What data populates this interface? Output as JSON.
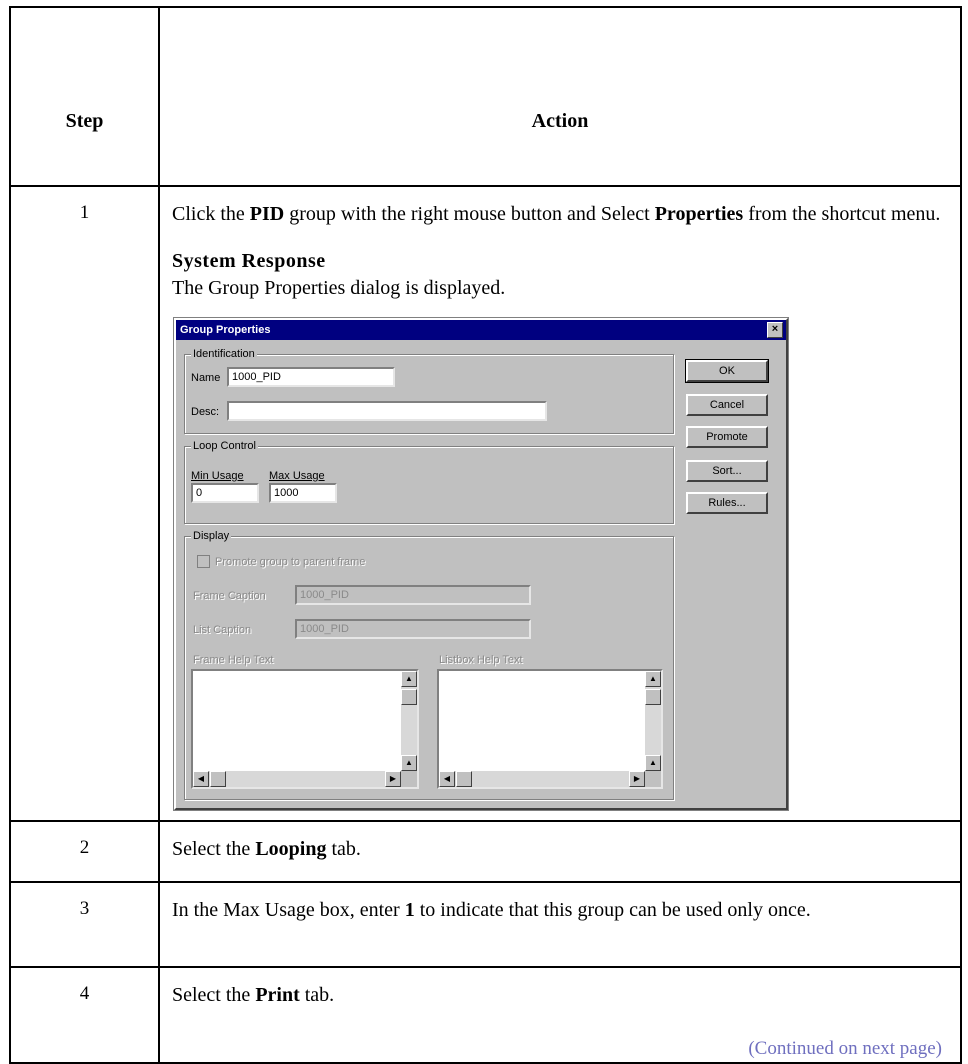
{
  "table": {
    "header_step": "Step",
    "header_action": "Action",
    "rows": [
      {
        "num": "1",
        "pre1": "Click the ",
        "b1": "PID",
        "mid1": " group with the right mouse button and Select ",
        "b2": "Properties",
        "post1": " from the shortcut menu.",
        "response_heading": "System Response",
        "response_text": "The Group Properties dialog is displayed."
      },
      {
        "num": "2",
        "pre": "Select the ",
        "bold": "Looping",
        "post": " tab."
      },
      {
        "num": "3",
        "pre": "In the Max Usage box, enter ",
        "bold": "1",
        "post": " to indicate that this group can be used only once."
      },
      {
        "num": "4",
        "pre": "Select the ",
        "bold": "Print",
        "post": " tab.",
        "continued": "(Continued on next page)"
      }
    ]
  },
  "dialog": {
    "title": "Group Properties",
    "close_glyph": "×",
    "identification": {
      "label": "Identification",
      "name_label": "Name",
      "name_value": "1000_PID",
      "desc_label": "Desc:",
      "desc_value": ""
    },
    "loop_control": {
      "label": "Loop Control",
      "min_label": "Min Usage",
      "min_value": "0",
      "max_label": "Max Usage",
      "max_value": "1000"
    },
    "display": {
      "label": "Display",
      "promote_checkbox": "Promote group to parent frame",
      "frame_caption_label": "Frame Caption",
      "frame_caption_value": "1000_PID",
      "list_caption_label": "List Caption",
      "list_caption_value": "1000_PID",
      "frame_help_label": "Frame Help Text",
      "listbox_help_label": "Listbox Help Text"
    },
    "buttons": {
      "ok": "OK",
      "cancel": "Cancel",
      "promote": "Promote",
      "sort": "Sort...",
      "rules": "Rules..."
    }
  }
}
